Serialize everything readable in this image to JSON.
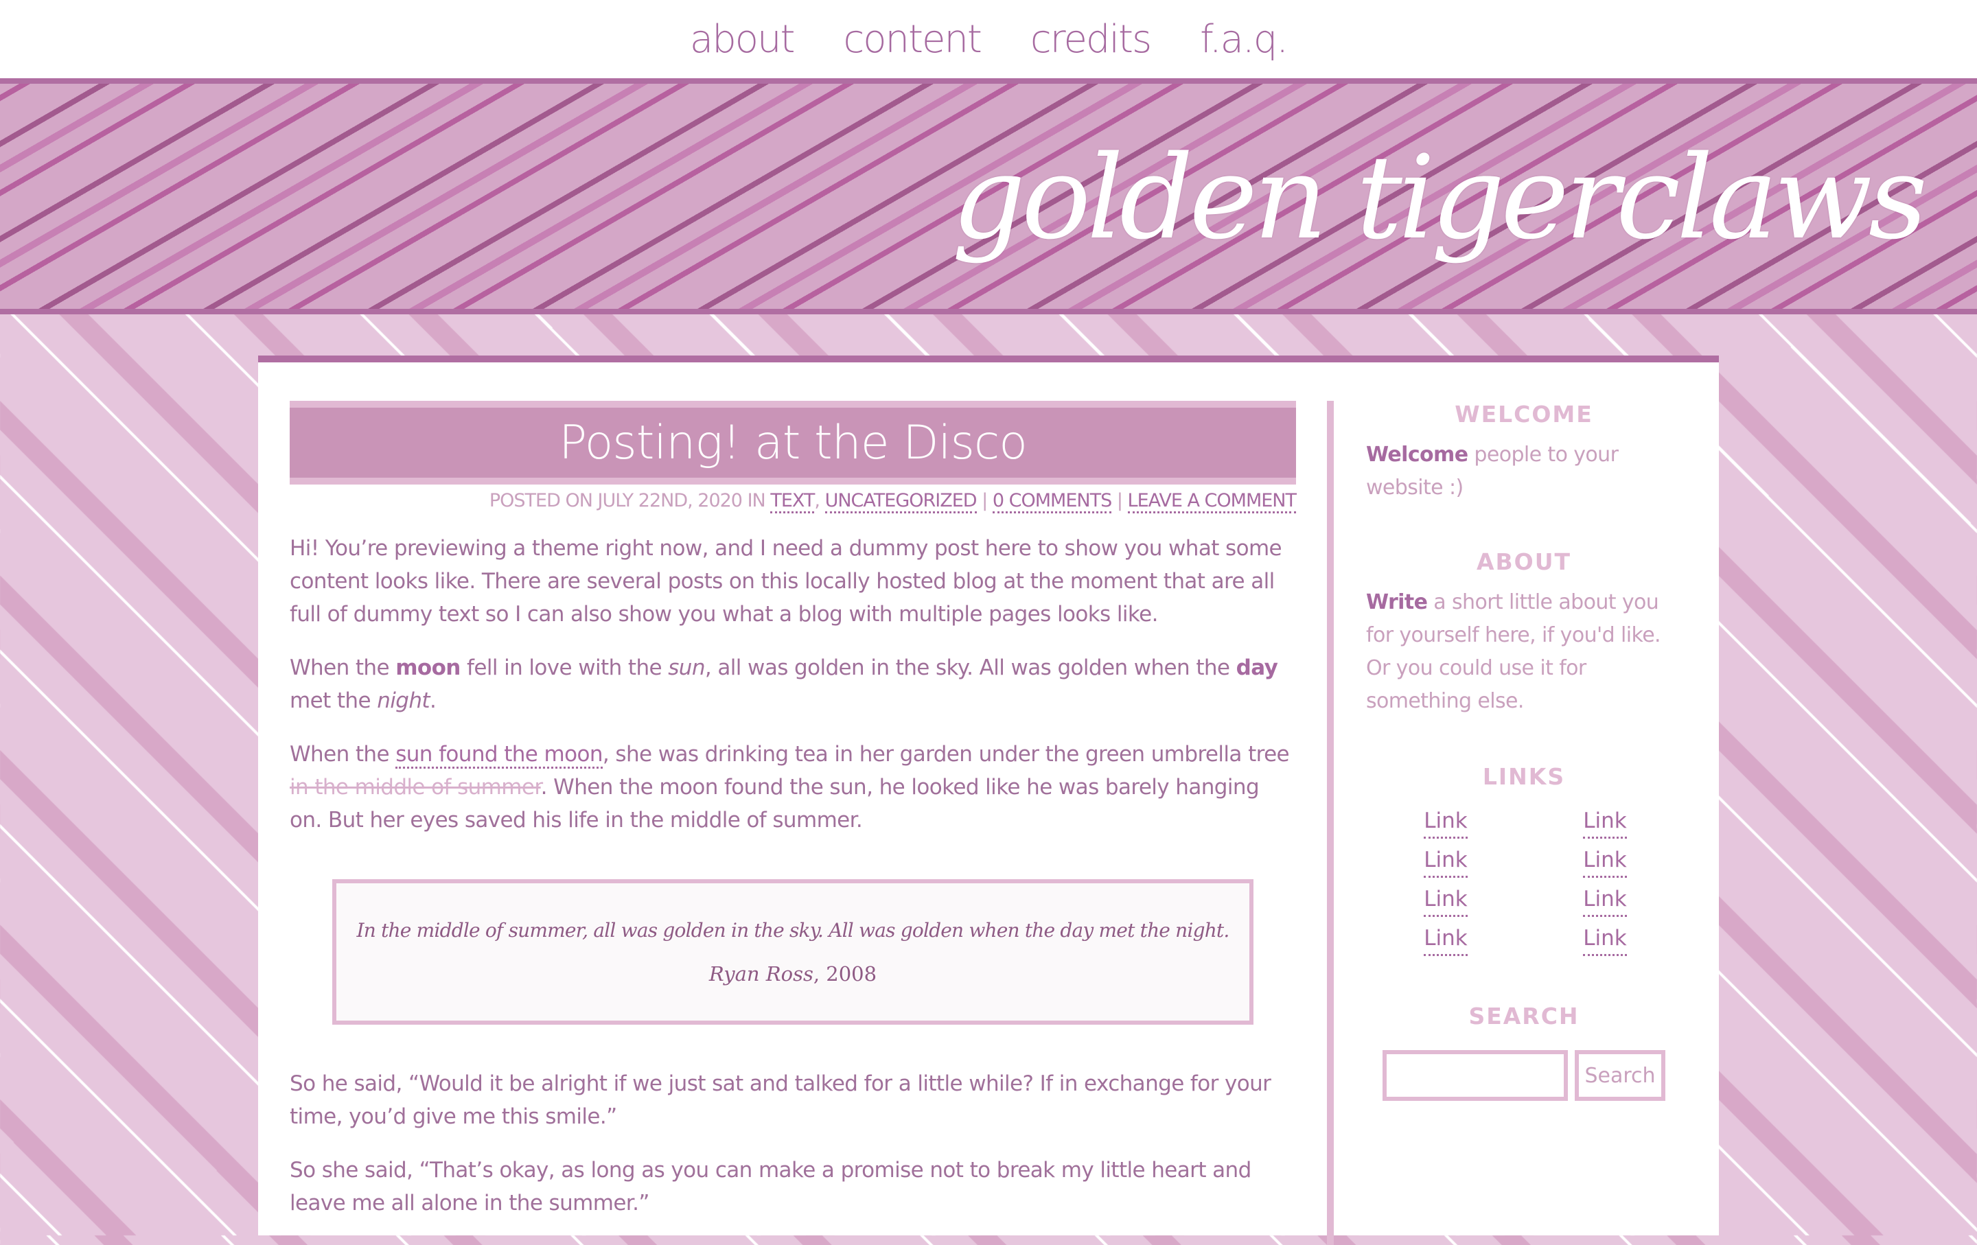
{
  "nav": {
    "items": [
      "about",
      "content",
      "credits",
      "f.a.q."
    ]
  },
  "header": {
    "site_title": "golden tigerclaws"
  },
  "post": {
    "title": "Posting! at the Disco",
    "meta": {
      "prefix": "POSTED ON JULY 22ND, 2020 IN",
      "cat1": "TEXT",
      "comma": ",",
      "cat2": "UNCATEGORIZED",
      "sep": "|",
      "comments": "0 COMMENTS",
      "leave": "LEAVE A COMMENT"
    },
    "p1": "Hi! You’re previewing a theme right now, and I need a dummy post here to show you what some content looks like. There are several posts on this locally hosted blog at the moment that are all full of dummy text so I can also show you what a blog with multiple pages looks like.",
    "p2": {
      "a": "When the ",
      "b": "moon",
      "c": " fell in love with the ",
      "d": "sun",
      "e": ", all was golden in the sky. All was golden when the ",
      "f": "day",
      "g": " met the ",
      "h": "night",
      "i": "."
    },
    "p3": {
      "a": "When the ",
      "link": "sun found the moon",
      "b": ", she was drinking tea in her garden under the green umbrella tree ",
      "strike": "in the middle of summer",
      "c": ". When the moon found the sun, he looked like he was barely hanging on. But her eyes saved his life in the middle of summer."
    },
    "quote": {
      "text": "In the middle of summer, all was golden in the sky. All was golden when the day met the night.",
      "author": "Ryan Ross",
      "year": ", 2008"
    },
    "p4": "So he said, “Would it be alright if we just sat and talked for a little while? If in exchange for your time, you’d give me this smile.”",
    "p5": "So she said, “That’s okay, as long as you can make a promise not to break my little heart and leave me all alone in the summer.”"
  },
  "sidebar": {
    "welcome_title": "WELCOME",
    "welcome_bold": "Welcome",
    "welcome_text": " people to your website :)",
    "about_title": "ABOUT",
    "about_bold": "Write",
    "about_text": " a short little about you for yourself here, if you'd like. Or you could use it for something else.",
    "links_title": "LINKS",
    "links": [
      "Link",
      "Link",
      "Link",
      "Link",
      "Link",
      "Link",
      "Link",
      "Link"
    ],
    "search_title": "SEARCH",
    "search_button": "Search"
  },
  "colors": {
    "accent": "#a66aa0",
    "title_bar": "#c994b7",
    "light": "#e1b9d3"
  }
}
